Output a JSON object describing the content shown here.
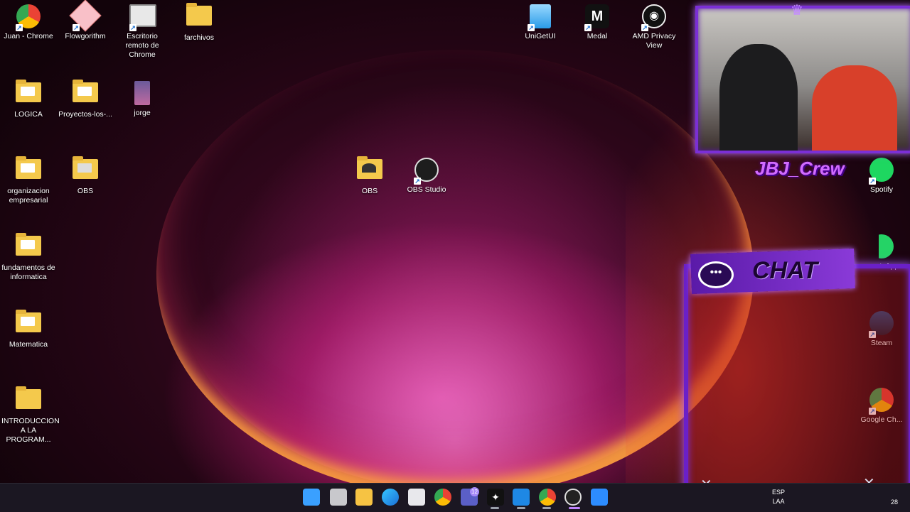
{
  "desktop": {
    "icons": [
      {
        "label": "Juan - Chrome",
        "icon": "chrome-profile-icon"
      },
      {
        "label": "Flowgorithm",
        "icon": "flowgorithm-icon"
      },
      {
        "label": "Escritorio remoto de Chrome",
        "icon": "chrome-remote-desktop-icon"
      },
      {
        "label": "farchivos",
        "icon": "folder-icon"
      },
      {
        "label": "LOGICA",
        "icon": "folder-icon"
      },
      {
        "label": "Proyectos-los-...",
        "icon": "folder-icon"
      },
      {
        "label": "jorge",
        "icon": "file-icon"
      },
      {
        "label": "organizacion empresarial",
        "icon": "folder-icon"
      },
      {
        "label": "OBS",
        "icon": "folder-icon"
      },
      {
        "label": "fundamentos de informatica",
        "icon": "folder-icon"
      },
      {
        "label": "Matematica",
        "icon": "folder-icon"
      },
      {
        "label": "INTRODUCCION A LA PROGRAM...",
        "icon": "folder-icon"
      },
      {
        "label": "OBS",
        "icon": "folder-icon"
      },
      {
        "label": "OBS Studio",
        "icon": "obs-studio-icon"
      },
      {
        "label": "UniGetUI",
        "icon": "unigetui-icon"
      },
      {
        "label": "Medal",
        "icon": "medal-icon"
      },
      {
        "label": "AMD Privacy View",
        "icon": "amd-privacy-view-icon"
      },
      {
        "label": "Spotify",
        "icon": "spotify-icon"
      },
      {
        "label": "WhatsApp",
        "icon": "whatsapp-icon"
      },
      {
        "label": "Steam",
        "icon": "steam-icon"
      },
      {
        "label": "Google Ch...",
        "icon": "google-chrome-icon"
      }
    ]
  },
  "overlay": {
    "crew_name": "JBJ_Crew",
    "chat_title": "CHAT",
    "accent_color": "#7b2fd6"
  },
  "taskbar": {
    "badge_count": "12",
    "language_line1": "ESP",
    "language_line2": "LAA",
    "clock_fragment": "28",
    "items": [
      "start-icon",
      "task-view-icon",
      "file-explorer-icon",
      "edge-icon",
      "microsoft-store-icon",
      "chrome-icon",
      "teams-icon",
      "tidal-icon",
      "vscode-icon",
      "chrome-dev-icon",
      "obs-studio-icon",
      "zoom-icon"
    ]
  }
}
